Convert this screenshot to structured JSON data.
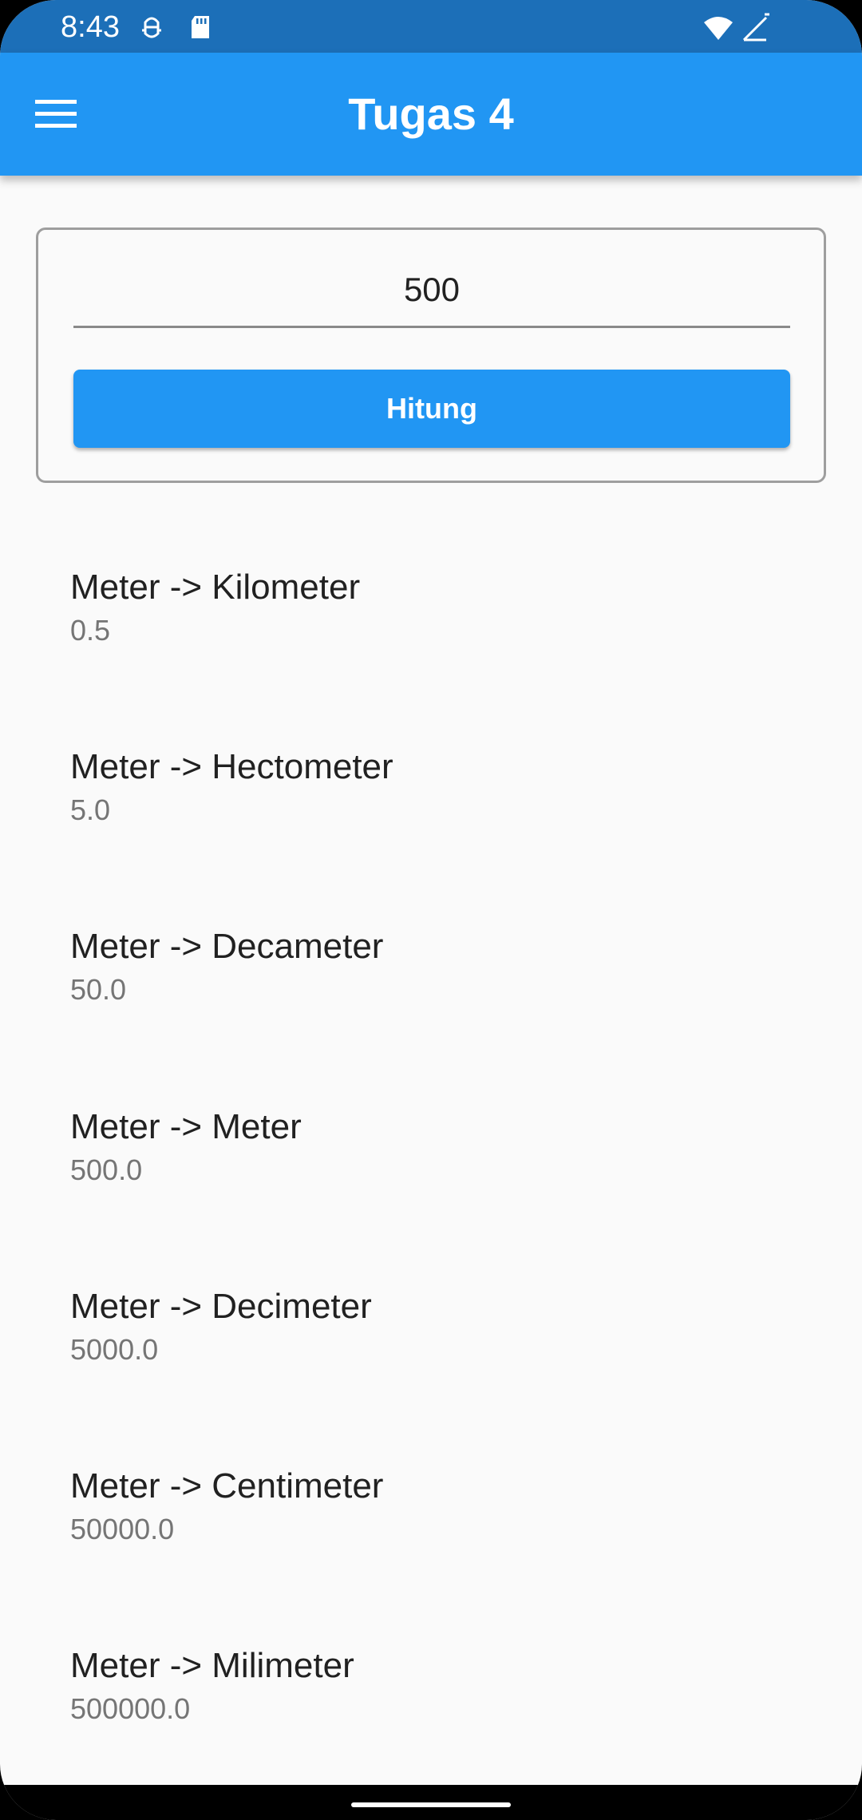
{
  "status_bar": {
    "time": "8:43",
    "icons": [
      "android-debug-icon",
      "sd-card-icon",
      "wifi-icon",
      "signal-icon"
    ]
  },
  "app_bar": {
    "title": "Tugas 4",
    "menu_icon": "hamburger-menu-icon",
    "color": "#2196f3"
  },
  "form": {
    "input_value": "500",
    "button_label": "Hitung"
  },
  "results": [
    {
      "label": "Meter -> Kilometer",
      "value": "0.5"
    },
    {
      "label": "Meter -> Hectometer",
      "value": "5.0"
    },
    {
      "label": "Meter -> Decameter",
      "value": "50.0"
    },
    {
      "label": "Meter -> Meter",
      "value": "500.0"
    },
    {
      "label": "Meter -> Decimeter",
      "value": "5000.0"
    },
    {
      "label": "Meter -> Centimeter",
      "value": "50000.0"
    },
    {
      "label": "Meter -> Milimeter",
      "value": "500000.0"
    }
  ]
}
